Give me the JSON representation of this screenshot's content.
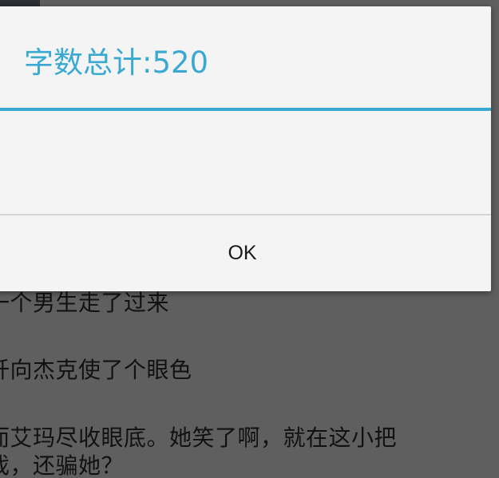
{
  "dialog": {
    "title": "字数总计:520",
    "ok_label": "OK"
  },
  "background_text": {
    "lines": [
      "一个男生走了过来",
      "钎向杰克使了个眼色",
      "而艾玛尽收眼底。她笑了啊，就在这小把",
      "戏，还骗她？"
    ]
  },
  "colors": {
    "accent": "#3aa9d1",
    "dialog_bg": "#f4f4f4",
    "scrim": "#5f5f5f"
  }
}
